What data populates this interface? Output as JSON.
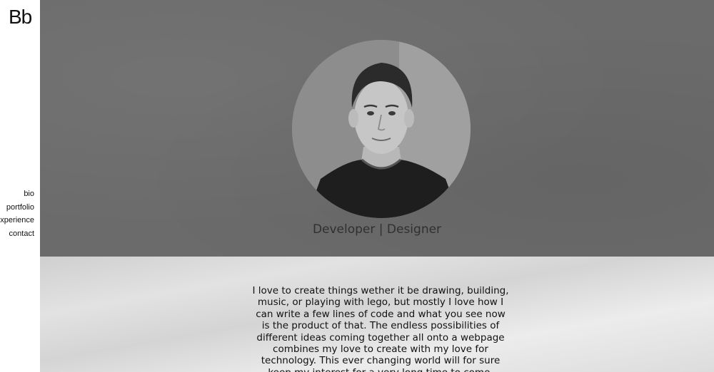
{
  "logo": "Bb",
  "nav": {
    "items": [
      {
        "label": "bio"
      },
      {
        "label": "portfolio"
      },
      {
        "label": "experience"
      },
      {
        "label": "contact"
      }
    ]
  },
  "hero": {
    "tagline": "Developer | Designer"
  },
  "bio": {
    "text": "I love to create things wether it be drawing, building, music, or playing with lego, but mostly I love how I can write a few lines of code and what you see now is the product of that. The endless possibilities of different ideas coming together all onto a webpage combines my love to create with my love for technology. This ever changing world will for sure keep my interest for a very long time to come."
  }
}
